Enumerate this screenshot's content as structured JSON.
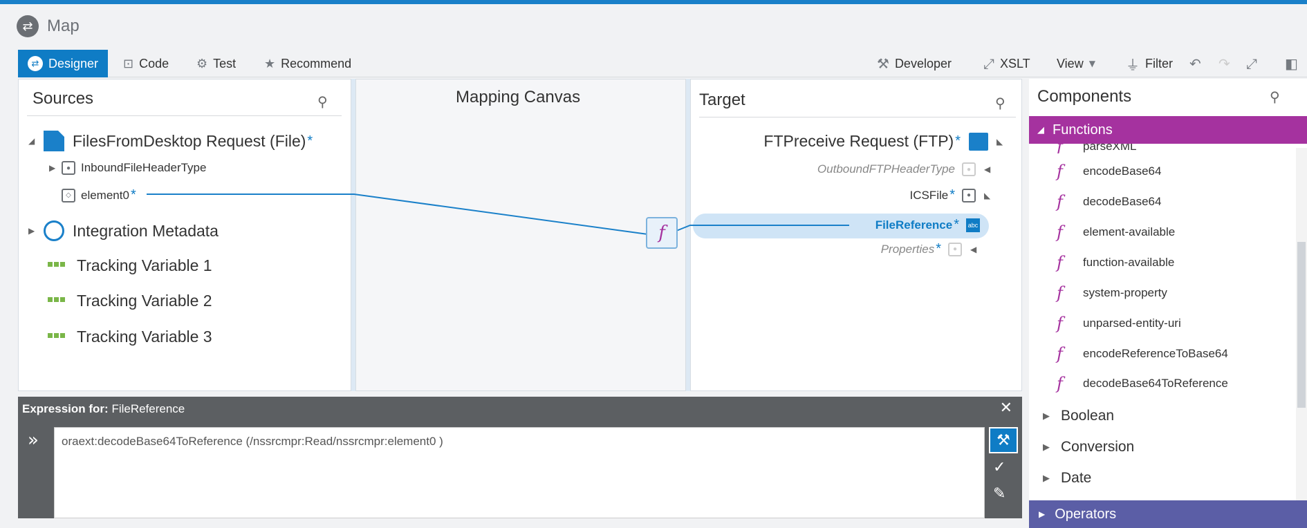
{
  "header": {
    "logo_icon": "map-icon",
    "title": "Map"
  },
  "toolbar": {
    "tabs": [
      {
        "label": "Designer",
        "icon": "designer-icon"
      },
      {
        "label": "Code",
        "icon": "code-icon"
      },
      {
        "label": "Test",
        "icon": "gear-icon"
      },
      {
        "label": "Recommend",
        "icon": "star-icon"
      }
    ],
    "right": [
      {
        "label": "Developer",
        "icon": "tools-icon"
      },
      {
        "label": "XSLT",
        "icon": "xslt-icon"
      },
      {
        "label": "View",
        "icon": "chevron-down-icon"
      },
      {
        "label": "Filter",
        "icon": "filter-icon"
      }
    ]
  },
  "sources": {
    "title": "Sources",
    "root": "FilesFromDesktop Request (File)",
    "child1": "InboundFileHeaderType",
    "child2": "element0",
    "integration": "Integration Metadata",
    "tracking": [
      "Tracking Variable 1",
      "Tracking Variable 2",
      "Tracking Variable 3"
    ]
  },
  "canvas": {
    "title": "Mapping Canvas",
    "function_glyph": "f"
  },
  "target": {
    "title": "Target",
    "root": "FTPreceive Request (FTP)",
    "outbound": "OutboundFTPHeaderType",
    "icsfile": "ICSFile",
    "fileref": "FileReference",
    "fileref_badge": "abc",
    "properties": "Properties"
  },
  "required_marker": "*",
  "components": {
    "title": "Components",
    "functions_label": "Functions",
    "partial_item": "parseXML",
    "functions": [
      "encodeBase64",
      "decodeBase64",
      "element-available",
      "function-available",
      "system-property",
      "unparsed-entity-uri",
      "encodeReferenceToBase64",
      "decodeBase64ToReference"
    ],
    "categories": [
      "Boolean",
      "Conversion",
      "Date"
    ],
    "operators_label": "Operators"
  },
  "expression": {
    "label": "Expression for:",
    "field": "FileReference",
    "value": "oraext:decodeBase64ToReference (/nssrcmpr:Read/nssrcmpr:element0 )"
  },
  "colors": {
    "accent": "#0f7cc5",
    "functions_bar": "#a5329f",
    "operators_bar": "#5b5ea6",
    "tracking": "#7ab648"
  }
}
